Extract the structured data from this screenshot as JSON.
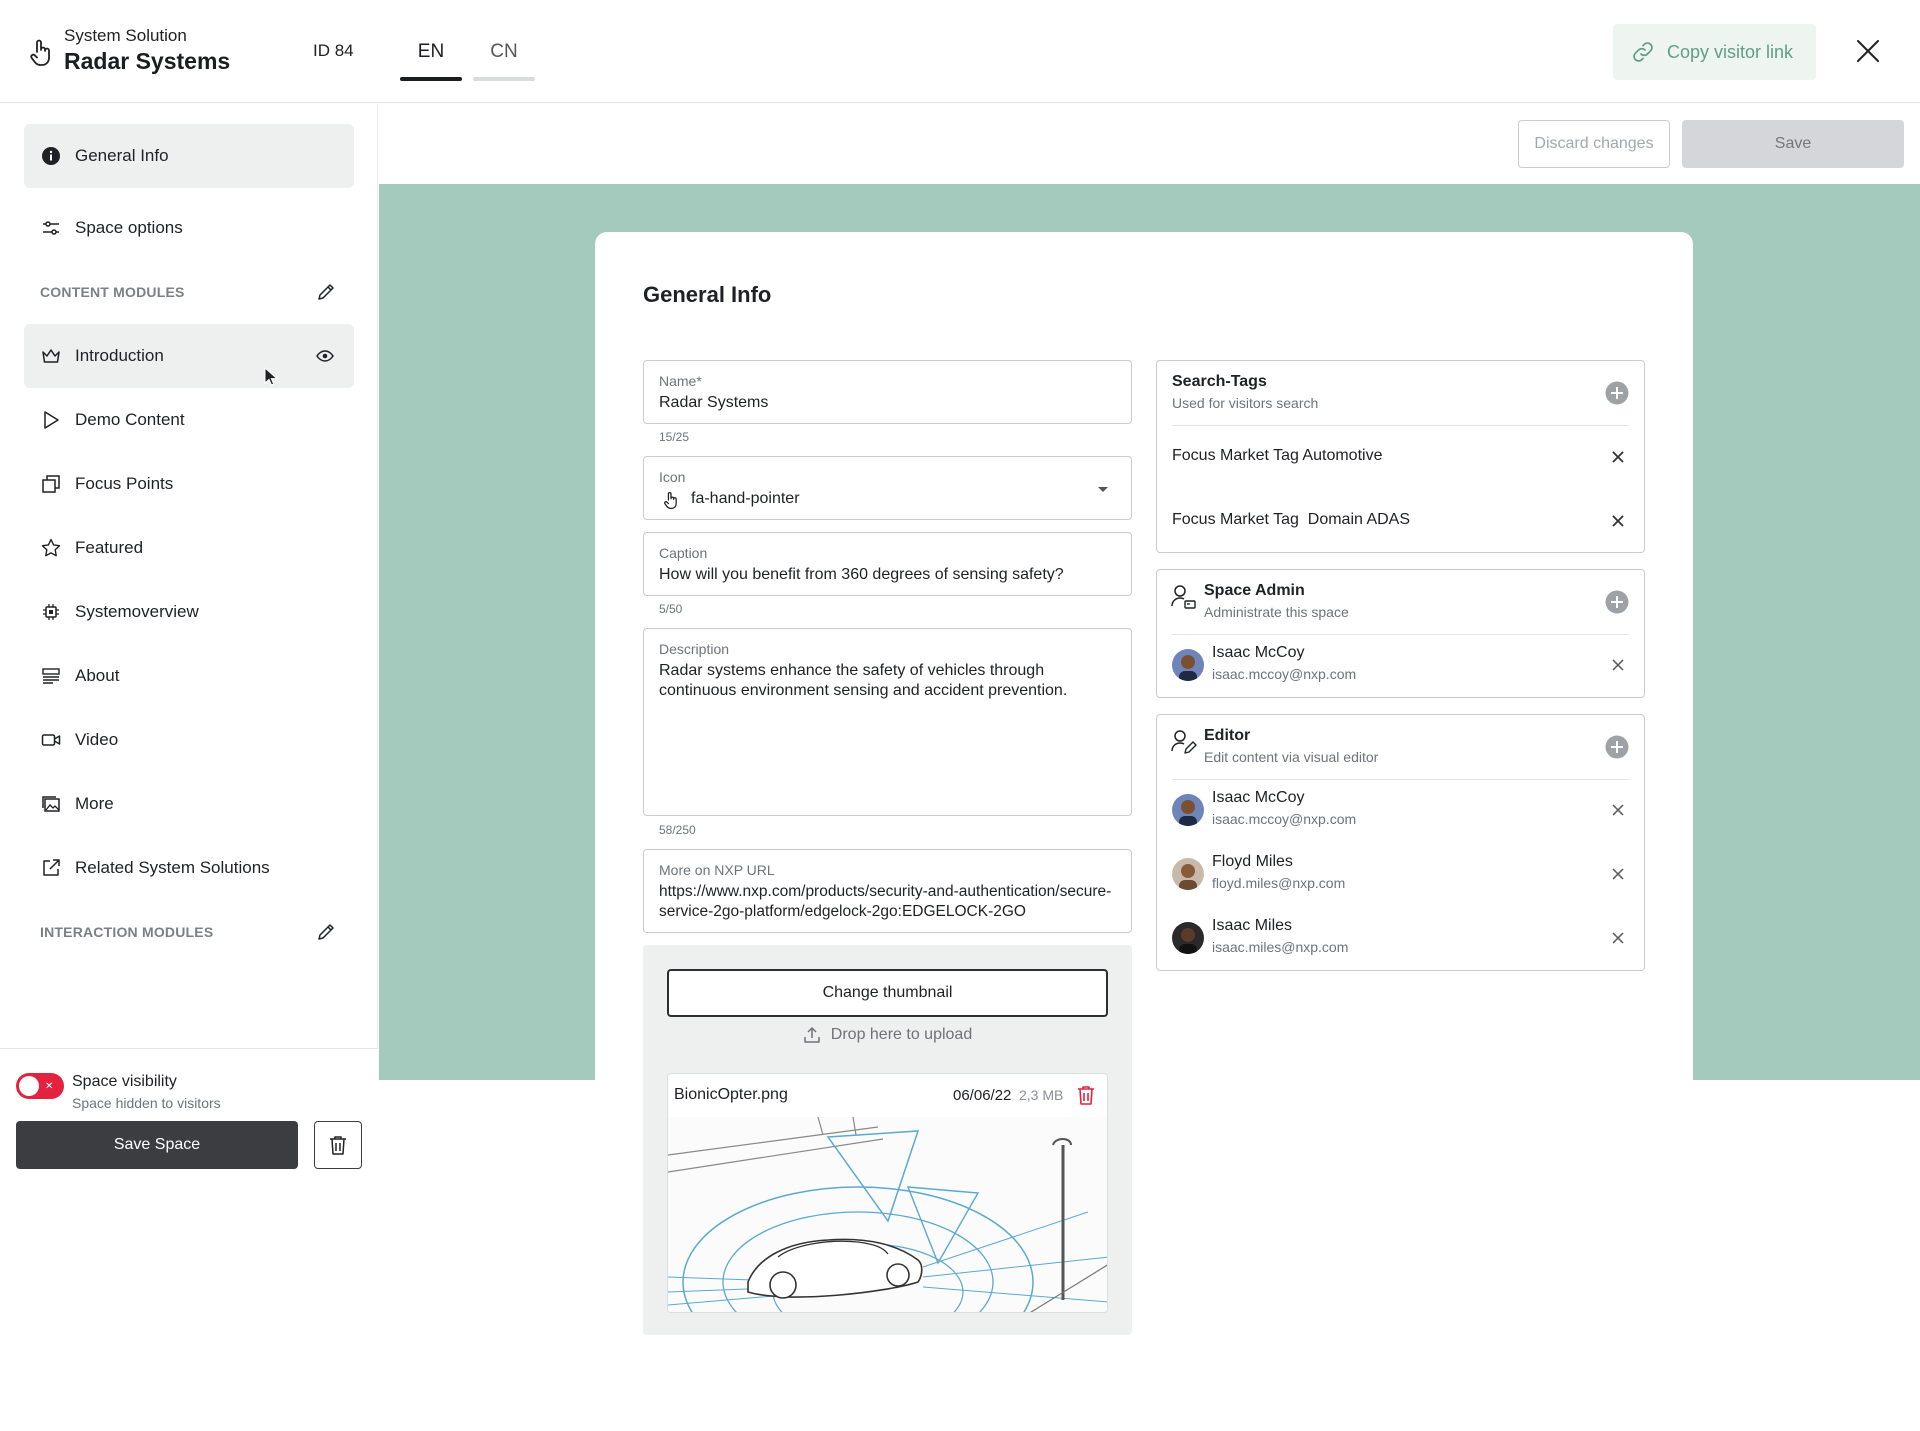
{
  "header": {
    "subtitle": "System Solution",
    "title": "Radar Systems",
    "id_label": "ID 84",
    "languages": [
      {
        "label": "EN",
        "active": true
      },
      {
        "label": "CN",
        "active": false
      }
    ],
    "copy_link_label": "Copy visitor link",
    "accent_color": "#5e9f88"
  },
  "sidebar": {
    "top_items": [
      {
        "label": "General Info",
        "icon": "info-circle-icon",
        "active": true
      },
      {
        "label": "Space options",
        "icon": "sliders-icon",
        "active": false
      }
    ],
    "content_modules_title": "CONTENT MODULES",
    "content_items": [
      {
        "label": "Introduction",
        "icon": "crown-icon",
        "active": true
      },
      {
        "label": "Demo Content",
        "icon": "play-icon"
      },
      {
        "label": "Focus Points",
        "icon": "windows-icon"
      },
      {
        "label": "Featured",
        "icon": "star-icon"
      },
      {
        "label": "Systemoverview",
        "icon": "chip-icon"
      },
      {
        "label": "About",
        "icon": "text-lines-icon"
      },
      {
        "label": "Video",
        "icon": "video-icon"
      },
      {
        "label": "More",
        "icon": "images-icon"
      },
      {
        "label": "Related System Solutions",
        "icon": "external-link-icon"
      }
    ],
    "interaction_modules_title": "INTERACTION MODULES",
    "visibility_title": "Space visibility",
    "visibility_subtitle": "Space hidden to visitors",
    "visibility_on": false,
    "save_space_label": "Save Space",
    "toggle_color": "#e2223f"
  },
  "actions": {
    "discard_label": "Discard changes",
    "save_label": "Save"
  },
  "main": {
    "background_color": "#a3cabc",
    "title": "General Info",
    "name": {
      "label": "Name*",
      "value": "Radar Systems",
      "counter": "15/25"
    },
    "icon": {
      "label": "Icon",
      "value": "fa-hand-pointer"
    },
    "caption": {
      "label": "Caption",
      "value": "How will you benefit from 360 degrees of sensing safety?",
      "counter": "5/50"
    },
    "description": {
      "label": "Description",
      "value": "Radar systems enhance the safety of vehicles through continuous environment sensing and accident prevention.",
      "counter": "58/250"
    },
    "url": {
      "label": "More on NXP URL",
      "value": "https://www.nxp.com/products/security-and-authentication/secure-service-2go-platform/edgelock-2go:EDGELOCK-2GO"
    },
    "thumbnail": {
      "change_label": "Change thumbnail",
      "drop_label": "Drop here to upload",
      "file_name": "BionicOpter.png",
      "file_date": "06/06/22",
      "file_size": "2,3 MB"
    },
    "search_tags": {
      "title": "Search-Tags",
      "subtitle": "Used for visitors search",
      "tags": [
        "Focus Market Tag Automotive",
        "Focus Market Tag  Domain ADAS"
      ]
    },
    "space_admin": {
      "title": "Space Admin",
      "subtitle": "Administrate this space",
      "people": [
        {
          "name": "Isaac McCoy",
          "email": "isaac.mccoy@nxp.com"
        }
      ]
    },
    "editor": {
      "title": "Editor",
      "subtitle": "Edit content via visual editor",
      "people": [
        {
          "name": "Isaac McCoy",
          "email": "isaac.mccoy@nxp.com"
        },
        {
          "name": "Floyd Miles",
          "email": "floyd.miles@nxp.com"
        },
        {
          "name": "Isaac Miles",
          "email": "isaac.miles@nxp.com"
        }
      ]
    },
    "delete_color": "#e2223f"
  }
}
